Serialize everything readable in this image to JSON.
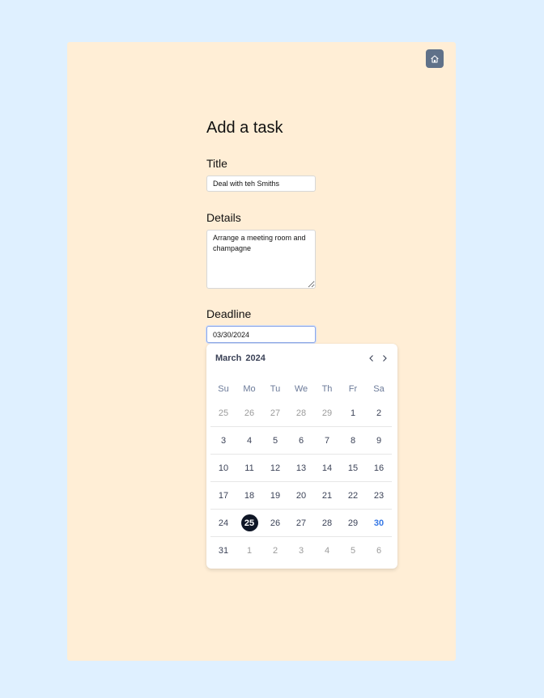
{
  "form": {
    "heading": "Add a task",
    "title_label": "Title",
    "title_value": "Deal with teh Smiths",
    "details_label": "Details",
    "details_value": "Arrange a meeting room and champagne",
    "deadline_label": "Deadline",
    "deadline_value": "03/30/2024"
  },
  "home_button": {
    "icon": "home-icon"
  },
  "calendar": {
    "month": "March",
    "year": "2024",
    "prev_icon": "chevron-left-icon",
    "next_icon": "chevron-right-icon",
    "weekdays": [
      "Su",
      "Mo",
      "Tu",
      "We",
      "Th",
      "Fr",
      "Sa"
    ],
    "weeks": [
      [
        "25",
        "26",
        "27",
        "28",
        "29",
        "1",
        "2"
      ],
      [
        "3",
        "4",
        "5",
        "6",
        "7",
        "8",
        "9"
      ],
      [
        "10",
        "11",
        "12",
        "13",
        "14",
        "15",
        "16"
      ],
      [
        "17",
        "18",
        "19",
        "20",
        "21",
        "22",
        "23"
      ],
      [
        "24",
        "25",
        "26",
        "27",
        "28",
        "29",
        "30"
      ],
      [
        "31",
        "1",
        "2",
        "3",
        "4",
        "5",
        "6"
      ]
    ],
    "today": "25",
    "selected": "30"
  },
  "colors": {
    "page_bg": "#dff0ff",
    "panel_bg": "#ffeed6",
    "home_button_bg": "#5f7189",
    "today_bg": "#0f1626",
    "selected_text": "#3577e5"
  }
}
